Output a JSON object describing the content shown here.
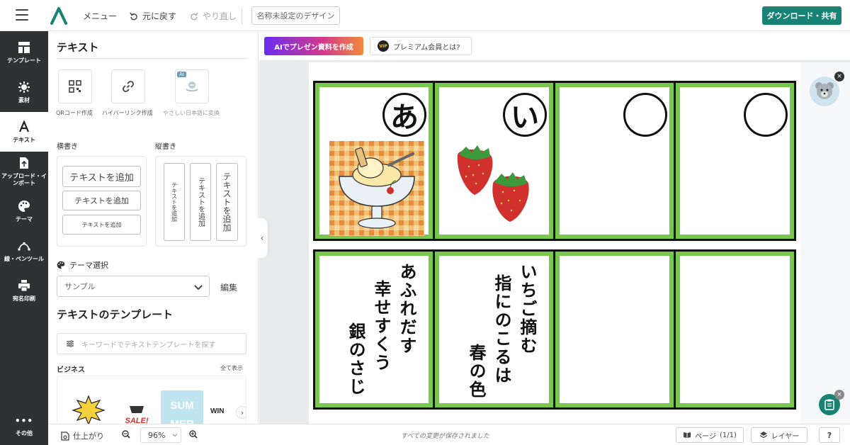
{
  "topbar": {
    "menu_label": "メニュー",
    "undo_label": "元に戻す",
    "redo_label": "やり直し",
    "doc_name": "名称未設定のデザイン",
    "download_label": "ダウンロード・共有"
  },
  "rail": {
    "items": [
      {
        "label": "テンプレート",
        "icon": "layout-icon"
      },
      {
        "label": "素材",
        "icon": "asset-icon"
      },
      {
        "label": "テキスト",
        "icon": "text-icon"
      },
      {
        "label": "アップロード・インポート",
        "icon": "upload-icon"
      },
      {
        "label": "テーマ",
        "icon": "palette-icon"
      },
      {
        "label": "線・ペンツール",
        "icon": "pen-tool-icon"
      },
      {
        "label": "宛名印刷",
        "icon": "printer-icon"
      },
      {
        "label": "その他",
        "icon": "more-icon"
      }
    ]
  },
  "panel": {
    "title": "テキスト",
    "tools": [
      {
        "label": "QRコード作成",
        "icon": "qr-code-icon"
      },
      {
        "label": "ハイパーリンク作成",
        "icon": "link-icon"
      },
      {
        "label": "やさしい日本語に変換",
        "icon": "easy-japanese-icon",
        "tag": "AI"
      }
    ],
    "horizontal_heading": "横書き",
    "vertical_heading": "縦書き",
    "add_text_large": "テキストを追加",
    "add_text_medium": "テキストを追加",
    "add_text_small": "テキストを追加",
    "add_vtext_small": "テキストを追加",
    "add_vtext_medium": "テキストを追加",
    "add_vtext_large": "テキストを追加",
    "theme_heading": "テーマ選択",
    "theme_value": "サンプル",
    "edit_label": "編集",
    "templates_title": "テキストのテンプレート",
    "search_placeholder": "キーワードでテキストテンプレートを探す",
    "business_heading": "ビジネス",
    "show_all": "全て表示"
  },
  "subbar": {
    "ai_button": "AIでプレゼン資料を作成",
    "vip_badge": "VIP",
    "vip_button": "プレミアム会員とは?"
  },
  "cards": {
    "top": [
      {
        "kana": "あ",
        "image": "ice-cream-sundae"
      },
      {
        "kana": "い",
        "image": "strawberries"
      },
      {
        "kana": "",
        "image": ""
      },
      {
        "kana": "",
        "image": ""
      }
    ],
    "bottom": [
      {
        "lines": [
          "あふれだす",
          "幸せすくう",
          "銀のさじ"
        ]
      },
      {
        "lines": [
          "いちご摘む",
          "指にのこるは",
          "春の色"
        ]
      },
      {
        "lines": []
      },
      {
        "lines": []
      }
    ]
  },
  "thumbs": {
    "t2_text": "SALE!",
    "t3_line1": "SUM",
    "t3_line2": "MER",
    "t4_text": "WIN"
  },
  "bottombar": {
    "finish_label": "仕上がり",
    "zoom": "96%",
    "saved_message": "すべての変更が保存されました",
    "pages_label": "ページ",
    "pages_count": "(1/1)",
    "layers_label": "レイヤー"
  },
  "colors": {
    "accent": "#188275",
    "card_green": "#78c84e",
    "rail_bg": "#2f3132"
  }
}
